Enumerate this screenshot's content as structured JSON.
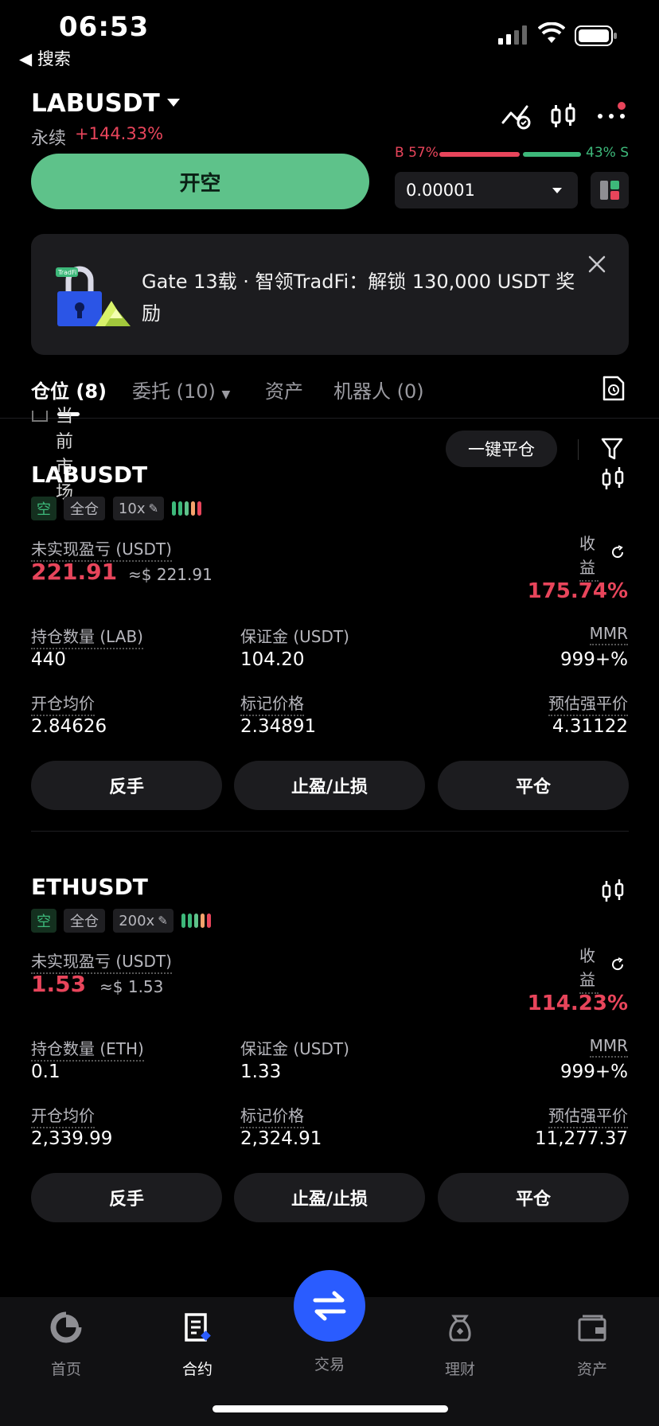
{
  "status_bar": {
    "time": "06:53",
    "back_label": "◀ 搜索"
  },
  "header": {
    "pair": "LABUSDT",
    "contract_type": "永续",
    "change": "+144.33%",
    "open_short_label": "开空",
    "ratio_buy_label": "B 57%",
    "ratio_sell_label": "43% S",
    "ratio_buy_fraction": 0.57,
    "precision": "0.00001"
  },
  "banner": {
    "text": "Gate 13载 · 智领TradFi：解锁 130,000 USDT 奖励",
    "art_label": "TradFi"
  },
  "tabs": [
    {
      "label": "仓位 (8)"
    },
    {
      "label": "委托 (10)"
    },
    {
      "label": "资产"
    },
    {
      "label": "机器人 (0)"
    }
  ],
  "filter": {
    "current_market": "当前市场",
    "close_all_label": "一键平仓"
  },
  "positions": [
    {
      "symbol": "LABUSDT",
      "side": "空",
      "margin_mode": "全仓",
      "leverage": "10x",
      "unrealized_pnl_label": "未实现盈亏 (USDT)",
      "unrealized_pnl": "221.91",
      "unrealized_pnl_usd": "≈$ 221.91",
      "roe_label": "收益",
      "roe": "175.74%",
      "qty_label": "持仓数量 (LAB)",
      "qty": "440",
      "margin_label": "保证金 (USDT)",
      "margin": "104.20",
      "mmr_label": "MMR",
      "mmr": "999+%",
      "entry_label": "开仓均价",
      "entry": "2.84626",
      "mark_label": "标记价格",
      "mark": "2.34891",
      "liq_label": "预估强平价",
      "liq": "4.31122",
      "btn_reverse": "反手",
      "btn_tpsl": "止盈/止损",
      "btn_close": "平仓"
    },
    {
      "symbol": "ETHUSDT",
      "side": "空",
      "margin_mode": "全仓",
      "leverage": "200x",
      "unrealized_pnl_label": "未实现盈亏 (USDT)",
      "unrealized_pnl": "1.53",
      "unrealized_pnl_usd": "≈$ 1.53",
      "roe_label": "收益",
      "roe": "114.23%",
      "qty_label": "持仓数量 (ETH)",
      "qty": "0.1",
      "margin_label": "保证金 (USDT)",
      "margin": "1.33",
      "mmr_label": "MMR",
      "mmr": "999+%",
      "entry_label": "开仓均价",
      "entry": "2,339.99",
      "mark_label": "标记价格",
      "mark": "2,324.91",
      "liq_label": "预估强平价",
      "liq": "11,277.37",
      "btn_reverse": "反手",
      "btn_tpsl": "止盈/止损",
      "btn_close": "平仓"
    }
  ],
  "bottom_nav": [
    {
      "label": "首页",
      "icon": "home-icon"
    },
    {
      "label": "合约",
      "icon": "contract-icon"
    },
    {
      "label": "交易",
      "icon": "swap-icon"
    },
    {
      "label": "理财",
      "icon": "finance-icon"
    },
    {
      "label": "资产",
      "icon": "wallet-icon"
    }
  ],
  "colors": {
    "accent_green": "#5ec28a",
    "red": "#e8455b",
    "green": "#3db87a",
    "orange": "#f5a26c",
    "fab_blue": "#2a5cff"
  }
}
